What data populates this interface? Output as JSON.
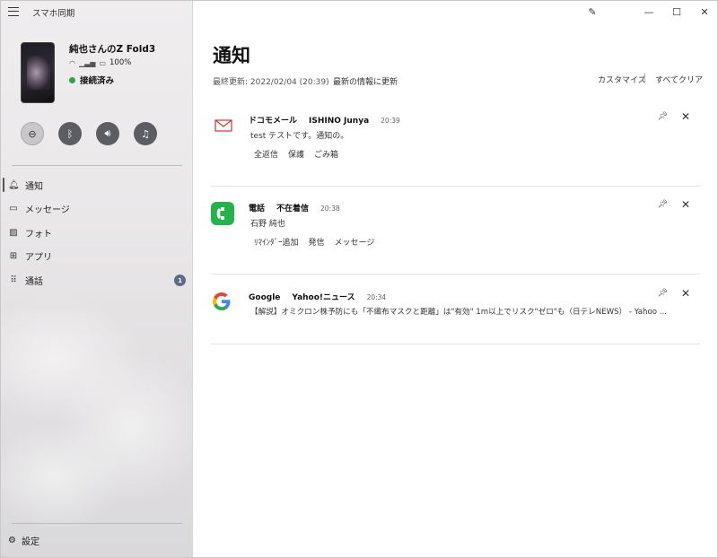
{
  "app": {
    "title": "スマホ同期"
  },
  "device": {
    "name": "純也さんのZ Fold3",
    "battery": "100%",
    "connection_status": "接続済み",
    "status_color": "#2ea44f"
  },
  "quick_actions": [
    {
      "icon": "do-not-disturb-icon"
    },
    {
      "icon": "bluetooth-icon"
    },
    {
      "icon": "volume-icon"
    },
    {
      "icon": "music-icon"
    }
  ],
  "nav": {
    "items": [
      {
        "label": "通知",
        "icon": "bell-icon",
        "active": true
      },
      {
        "label": "メッセージ",
        "icon": "message-icon"
      },
      {
        "label": "フォト",
        "icon": "photo-icon"
      },
      {
        "label": "アプリ",
        "icon": "apps-icon"
      },
      {
        "label": "通話",
        "icon": "dialpad-icon",
        "badge": "1"
      }
    ],
    "settings_label": "設定"
  },
  "main": {
    "title": "通知",
    "last_update": "最終更新: 2022/02/04 (20:39)",
    "refresh_label": "最新の情報に更新",
    "customize_label": "カスタマイズ",
    "clear_all_label": "すべてクリア"
  },
  "notifications": [
    {
      "app": "ドコモメール",
      "sender": "ISHINO Junya",
      "time": "20:39",
      "body": "test テストです。通知の。",
      "actions": [
        "全返信",
        "保護",
        "ごみ箱"
      ],
      "icon": "mail-icon"
    },
    {
      "app": "電話",
      "sender": "不在着信",
      "time": "20:38",
      "body": "石野 純也",
      "actions": [
        "ﾘﾏｲﾝﾀﾞｰ追加",
        "発信",
        "メッセージ"
      ],
      "icon": "phone-app-icon",
      "accent": "#24b34b"
    },
    {
      "app": "Google",
      "sender": "Yahoo!ニュース",
      "time": "20:34",
      "body": "【解説】オミクロン株予防にも「不織布マスクと距離」は\"有効\" 1m以上でリスク\"ゼロ\"も（日テレNEWS） - Yahoo ...",
      "actions": [],
      "icon": "google-icon"
    }
  ]
}
